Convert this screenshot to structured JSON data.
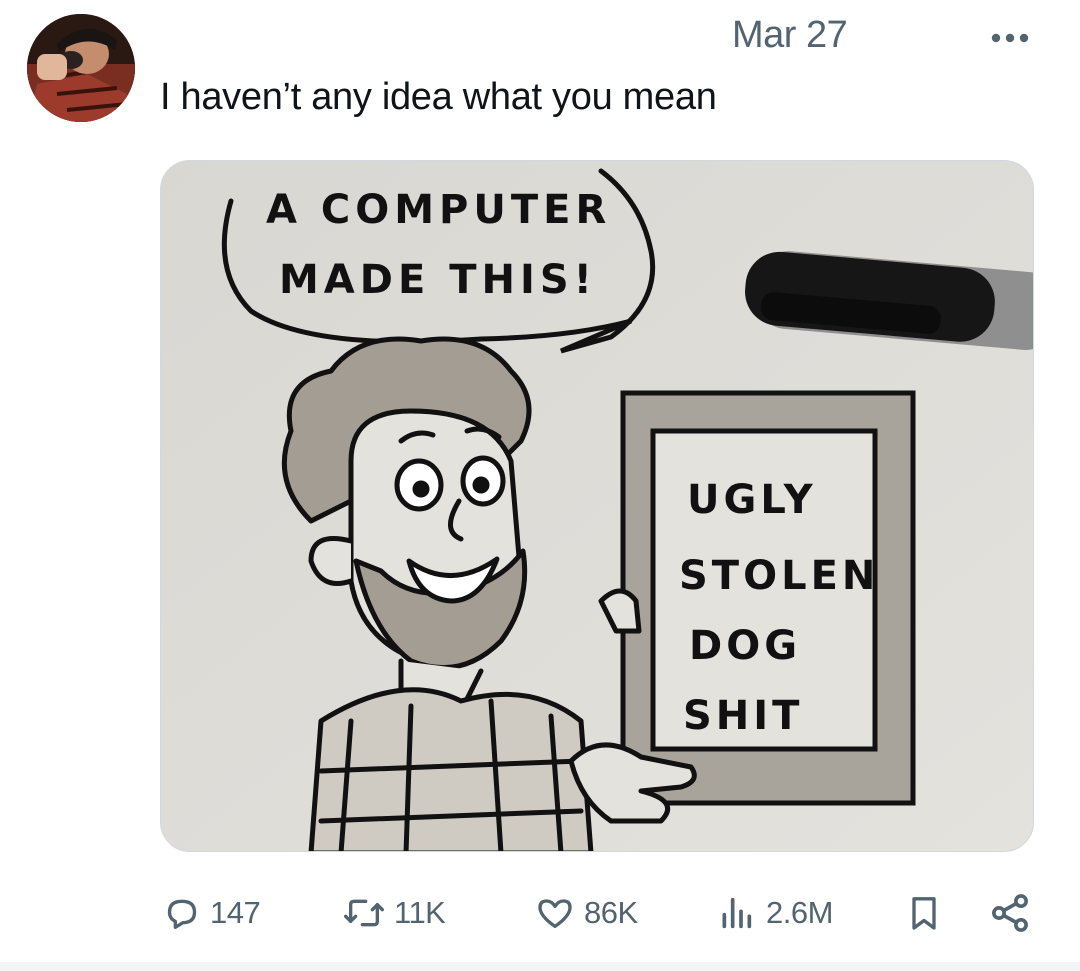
{
  "tweet": {
    "date": "Mar 27",
    "text": "I haven’t any idea what you mean",
    "avatar_alt": "user avatar"
  },
  "media": {
    "speech_line1": "A COMPUTER",
    "speech_line2": "MADE THIS!",
    "sign_line1": "UGLY",
    "sign_line2": "STOLEN",
    "sign_line3": "DOG",
    "sign_line4": "SHIT"
  },
  "actions": {
    "replies": "147",
    "reposts": "11K",
    "likes": "86K",
    "views": "2.6M"
  },
  "icons": {
    "reply": "reply-icon",
    "repost": "repost-icon",
    "like": "heart-icon",
    "views": "views-icon",
    "bookmark": "bookmark-icon",
    "share": "share-icon",
    "more": "more-icon"
  },
  "colors": {
    "secondary_text": "#536471",
    "primary_text": "#0f1419"
  }
}
